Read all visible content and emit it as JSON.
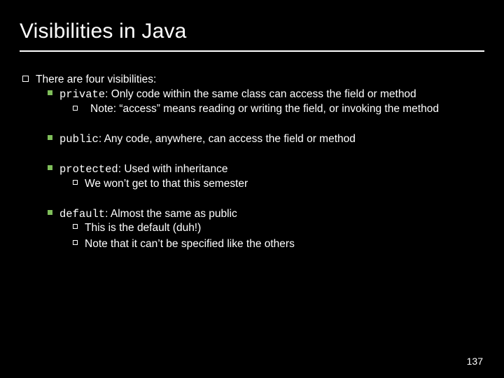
{
  "title": "Visibilities in Java",
  "content": {
    "intro": "There are four visibilities:",
    "items": [
      {
        "kw": "private",
        "rest": ": Only code within the same class can access the field or method",
        "sub": [
          {
            "label": "Note: “access” means reading or writing the field, or invoking the method"
          }
        ]
      },
      {
        "kw": "public",
        "rest": ": Any code, anywhere, can access the field or method",
        "sub": []
      },
      {
        "kw": "protected",
        "rest": ": Used with inheritance",
        "sub": [
          {
            "label": "We won’t get to that this semester"
          }
        ]
      },
      {
        "kw": "default",
        "rest": ": Almost the same as public",
        "sub": [
          {
            "label": "This is the default (duh!)"
          },
          {
            "label": "Note that it can’t be specified like the others"
          }
        ]
      }
    ]
  },
  "page_number": "137"
}
